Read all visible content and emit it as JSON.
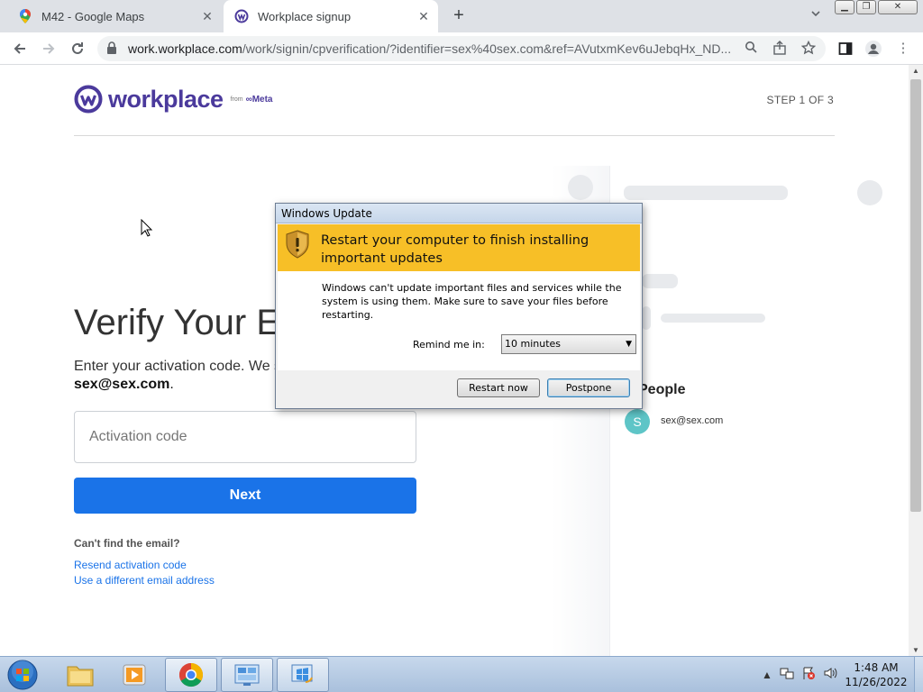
{
  "browser": {
    "tabs": [
      {
        "title": "M42 - Google Maps",
        "icon": "google-maps-icon"
      },
      {
        "title": "Workplace signup",
        "icon": "workplace-icon",
        "active": true
      }
    ],
    "url_host": "work.workplace.com",
    "url_path": "/work/signin/cpverification/?identifier=sex%40sex.com&ref=AVutxmKev6uJebqHx_ND..."
  },
  "page": {
    "logo_text": "workplace",
    "logo_from": "from",
    "logo_meta": "∞Meta",
    "step": "STEP 1 OF 3",
    "headline": "Verify Your Email",
    "instruction": "Enter your activation code. We sent it to",
    "email": "sex@sex.com",
    "email_suffix": ".",
    "code_placeholder": "Activation code",
    "next_label": "Next",
    "cant_find": "Can't find the email?",
    "resend_link": "Resend activation code",
    "different_link": "Use a different email address",
    "people_label": "People",
    "avatar_letter": "S",
    "avatar_email": "sex@sex.com"
  },
  "dialog": {
    "title": "Windows Update",
    "banner": "Restart your computer to finish installing important updates",
    "message": "Windows can't update important files and services while the system is using them. Make sure to save your files before restarting.",
    "remind_label": "Remind me in:",
    "remind_value": "10 minutes",
    "restart_label": "Restart now",
    "postpone_label": "Postpone",
    "banner_color": "#f7bf27"
  },
  "taskbar": {
    "time": "1:48 AM",
    "date": "11/26/2022"
  },
  "colors": {
    "accent": "#1a73e8",
    "brand": "#4b3a9c"
  }
}
